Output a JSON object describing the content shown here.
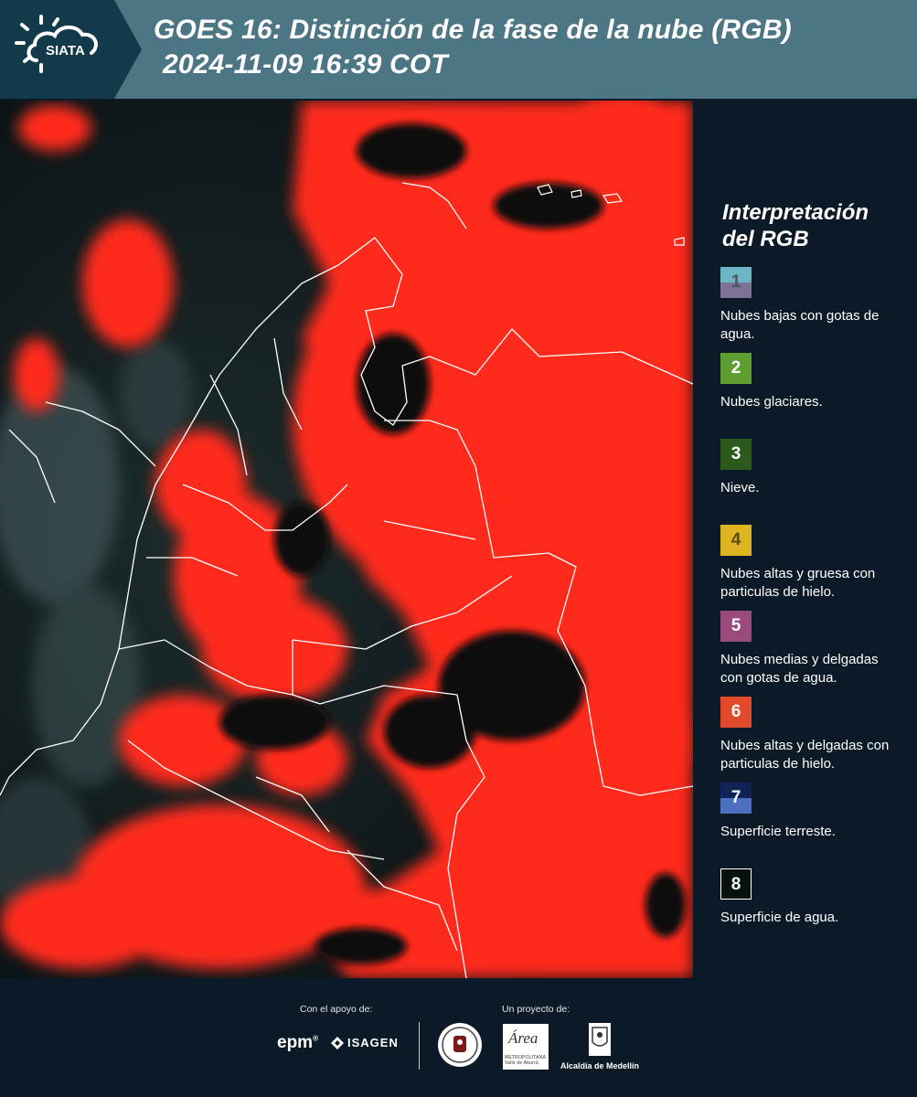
{
  "header": {
    "logo_text": "SIATA",
    "title_line1": "GOES 16: Distinción de la fase de la nube (RGB)",
    "title_line2": "2024-11-09 16:39 COT",
    "bg_color": "#4d7685",
    "logo_panel_color": "#123a4b"
  },
  "map": {
    "description_colors": {
      "cloud": "#ff2a1a",
      "ground": "#0d1a1c",
      "borders": "#ffffff"
    }
  },
  "legend": {
    "title_line1": "Interpretación",
    "title_line2": "del RGB",
    "items": [
      {
        "number": "1",
        "label": "Nubes bajas con gotas de agua.",
        "color_top": "#6bb6c6",
        "color_bottom": "#7d7394",
        "text_color": "#4d5560"
      },
      {
        "number": "2",
        "label": "Nubes glaciares.",
        "color": "#5e9d31",
        "text_color": "#ffffff"
      },
      {
        "number": "3",
        "label": "Nieve.",
        "color": "#2c5a1c",
        "text_color": "#ffffff"
      },
      {
        "number": "4",
        "label": "Nubes altas y gruesa con particulas de hielo.",
        "color": "#ddb421",
        "text_color": "#5a4a10"
      },
      {
        "number": "5",
        "label": "Nubes medias y delgadas con gotas de agua.",
        "color": "#9b4a7c",
        "text_color": "#ffffff"
      },
      {
        "number": "6",
        "label": "Nubes altas y delgadas con particulas de hielo.",
        "color": "#e24a2c",
        "text_color": "#ffffff"
      },
      {
        "number": "7",
        "label": "Superficie terreste.",
        "color_top": "#0f2358",
        "color_bottom": "#4c6fc1",
        "text_color": "#ffffff"
      },
      {
        "number": "8",
        "label": "Superficie de agua.",
        "color": "#08120d",
        "border": "#ffffff",
        "text_color": "#ffffff"
      }
    ]
  },
  "footer": {
    "support_label": "Con el apoyo de:",
    "project_label": "Un proyecto de:",
    "sponsor1": "epm",
    "sponsor2": "ISAGEN",
    "area_logo_text": "Área",
    "area_logo_sub": "METROPOLITANA Valle de Aburrá",
    "alcaldia": "Alcaldía de Medellín"
  }
}
